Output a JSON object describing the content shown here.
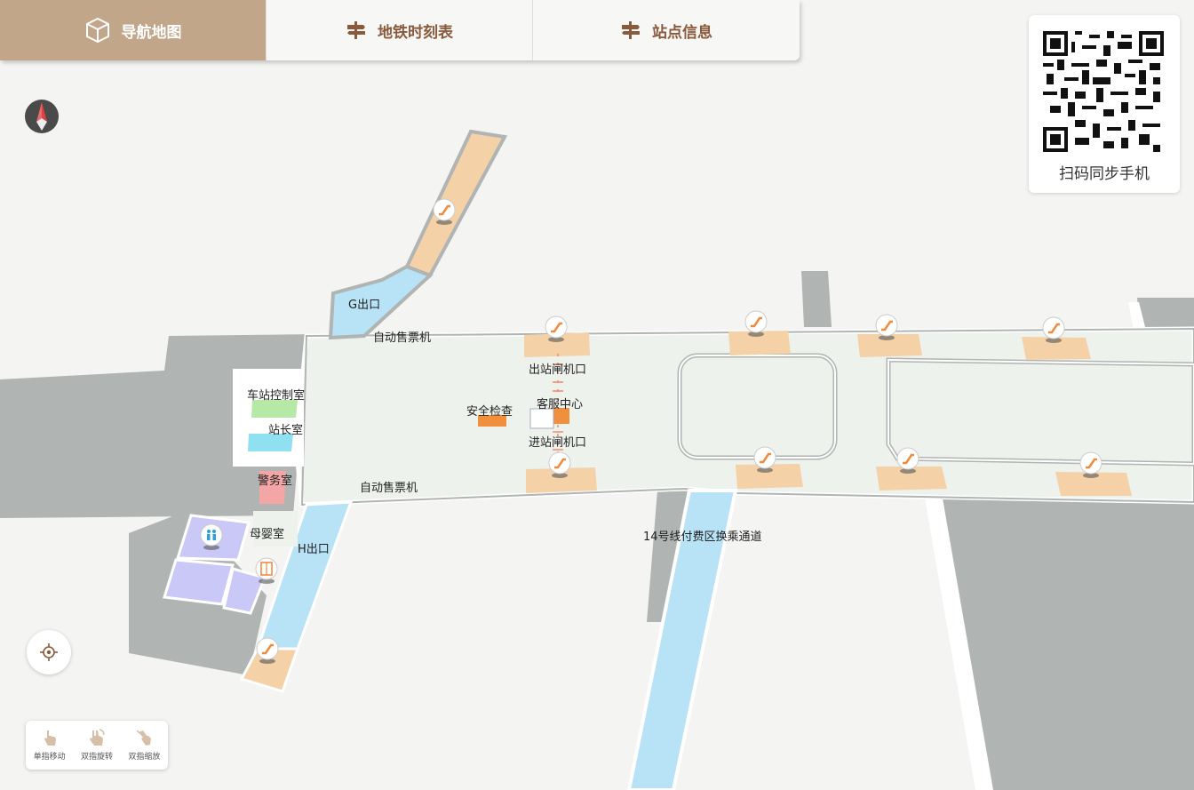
{
  "tabs": [
    {
      "label": "导航地图",
      "icon": "cube-icon",
      "active": true
    },
    {
      "label": "地铁时刻表",
      "icon": "signpost-icon",
      "active": false
    },
    {
      "label": "站点信息",
      "icon": "signpost-icon",
      "active": false
    }
  ],
  "qr": {
    "label": "扫码同步手机"
  },
  "map_labels": {
    "g_exit": "G出口",
    "ticket_machine_top": "自动售票机",
    "exit_gate": "出站闸机口",
    "control_room": "车站控制室",
    "service_center": "客服中心",
    "security_check": "安全检查",
    "master_room": "站长室",
    "entry_gate": "进站闸机口",
    "police_room": "警务室",
    "ticket_machine_bottom": "自动售票机",
    "nursery": "母婴室",
    "h_exit": "H出口",
    "transfer_passage": "14号线付费区换乘通道"
  },
  "gestures": [
    {
      "label": "单指移动",
      "icon": "one-finger-move-icon"
    },
    {
      "label": "双指旋转",
      "icon": "two-finger-rotate-icon"
    },
    {
      "label": "双指缩放",
      "icon": "two-finger-zoom-icon"
    }
  ],
  "colors": {
    "accent": "#c2a68a",
    "tab_text": "#8a5a3c",
    "floor": "#eef2ec",
    "walls": "#b0b4b3",
    "escalator_area": "#f5d1a8",
    "exit_passage": "#b8e2f5",
    "escalator_icon": "#f08a3c"
  }
}
